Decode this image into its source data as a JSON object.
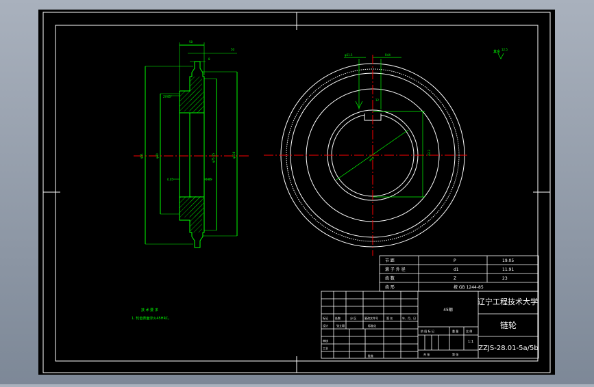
{
  "colors": {
    "background_gradient_top": "#a9b1bd",
    "background_gradient_bottom": "#7d8897",
    "canvas": "#000000",
    "border": "#ffffff",
    "geometry": "#00ff00",
    "centerline": "#ff0000",
    "hatch": "#00ff00"
  },
  "side_view": {
    "dim_top": "58",
    "dim_hub": "50",
    "dim_chamfer": "8",
    "dim_left": "φ54",
    "dim_mid": "φ40",
    "dim_right": "φ138",
    "dim_hub_dia": "φ75.15",
    "dim_small": "2×45°",
    "dim_tol_left": "0.05",
    "dim_tol_right": "0.05"
  },
  "front_view": {
    "label_top_left": "φ51.5",
    "label_top_right": "R44",
    "label_keyway": "12",
    "label_diameter": "φ40",
    "label_right": "43.3"
  },
  "roughness_note": {
    "text": "其余",
    "value": "12.5"
  },
  "tech_requirements": {
    "title": "技 术 要 求",
    "item_1": "1. 轮齿表面淬火45HRC。"
  },
  "param_table": {
    "rows": [
      {
        "name": "节 距",
        "symbol": "P",
        "value": "19.05"
      },
      {
        "name": "滚 子 外 径",
        "symbol": "d1",
        "value": "11.91"
      },
      {
        "name": "齿 数",
        "symbol": "Z",
        "value": "23"
      },
      {
        "name": "齿 形",
        "symbol": "",
        "value": "按 GB 1244-85"
      }
    ]
  },
  "title_block": {
    "school": "辽宁工程技术大学",
    "part_name": "链轮",
    "drawing_no": "ZZJS-28.01-5a/5b",
    "material": "45钢",
    "scale": "1:1",
    "stage_label": "阶 段 标 记",
    "weight_label": "重 量",
    "scale_label": "比 例",
    "sheet_label": "共 张",
    "sheet_label2": "第 张",
    "header_cells": [
      "标记",
      "处数",
      "分 区",
      "更改文件号",
      "签 名",
      "年、月、日"
    ],
    "role_design": "设计",
    "role_standard": "标准化",
    "role_check": "审核",
    "role_approve": "批准",
    "role_process": "工艺",
    "name_design": "张立翔"
  }
}
